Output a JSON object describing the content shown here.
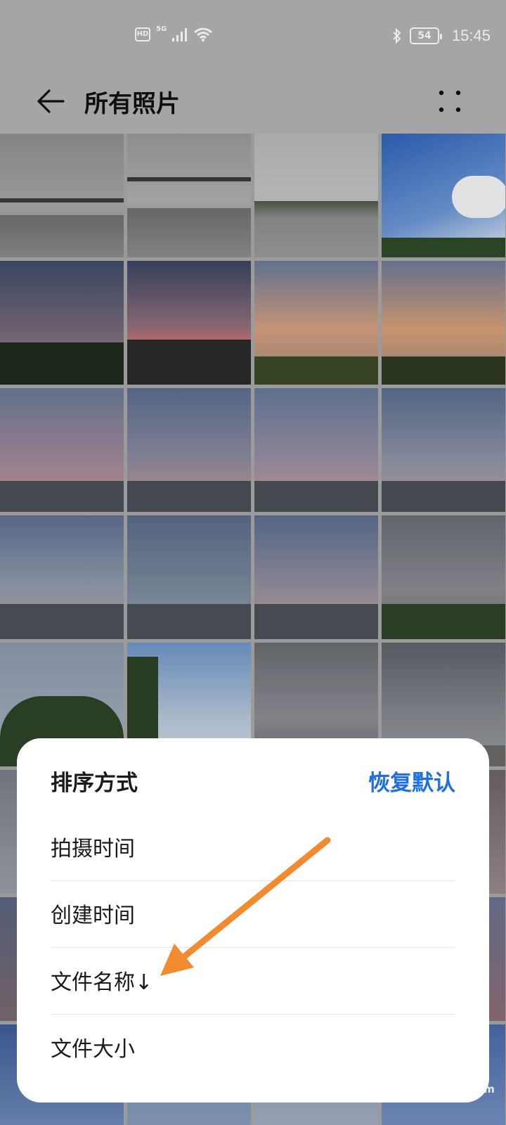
{
  "status_bar": {
    "hd": "HD",
    "network": "5G",
    "battery": "54",
    "time": "15:45"
  },
  "header": {
    "title": "所有照片"
  },
  "sort_sheet": {
    "title": "排序方式",
    "reset_label": "恢复默认",
    "options": [
      {
        "label": "拍摄时间"
      },
      {
        "label": "创建时间"
      },
      {
        "label": "文件名称↓"
      },
      {
        "label": "文件大小"
      }
    ]
  },
  "watermark": "jingyan.baidu.com",
  "colors": {
    "accent": "#1f6fe0",
    "annotation": "#f28a30"
  }
}
